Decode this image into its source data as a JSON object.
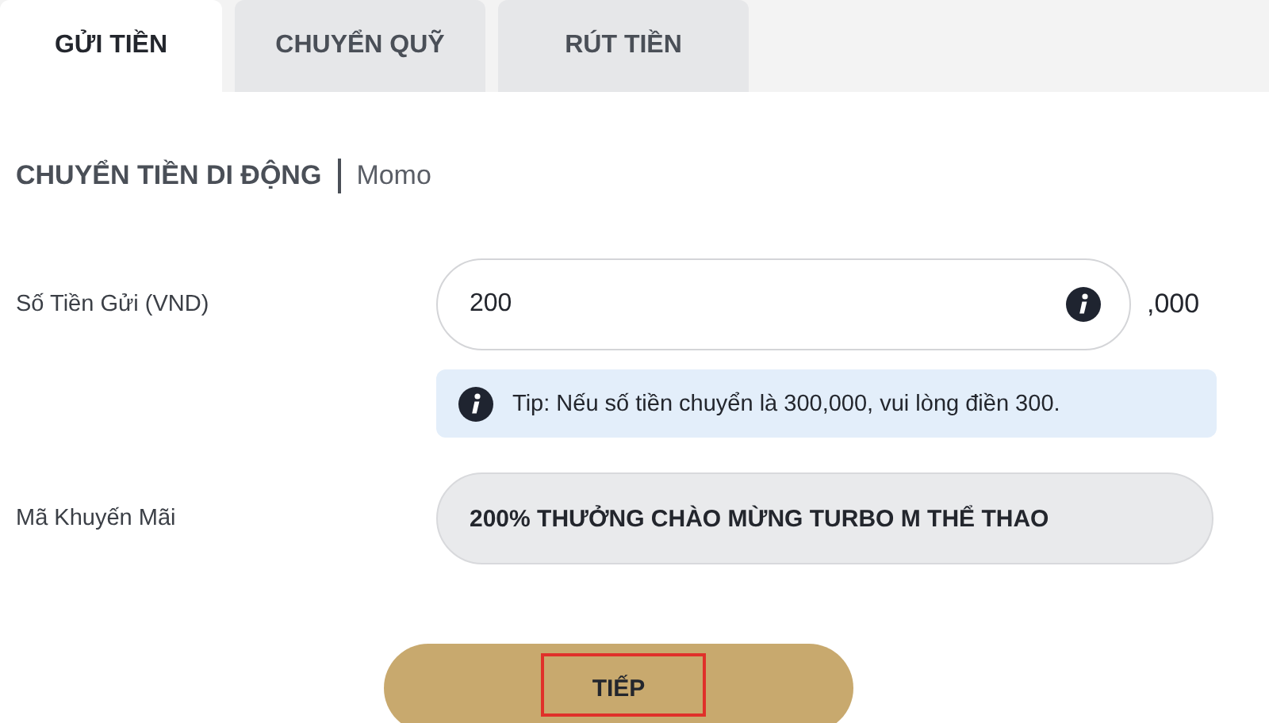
{
  "tabs": [
    {
      "label": "GỬI TIỀN",
      "selected": true
    },
    {
      "label": "CHUYỂN QUỸ",
      "selected": false
    },
    {
      "label": "RÚT TIỀN",
      "selected": false
    }
  ],
  "heading": {
    "title": "CHUYỂN TIỀN DI ĐỘNG",
    "method": "Momo"
  },
  "amount": {
    "label": "Số Tiền Gửi (VND)",
    "value": "200",
    "suffix": ",000",
    "tip": "Tip: Nếu số tiền chuyển là 300,000, vui lòng điền 300."
  },
  "promo": {
    "label": "Mã Khuyến Mãi",
    "value": "200% THƯỞNG CHÀO MỪNG TURBO M THỂ THAO"
  },
  "buttons": [
    {
      "label": "TIẾP",
      "highlighted": true
    }
  ]
}
